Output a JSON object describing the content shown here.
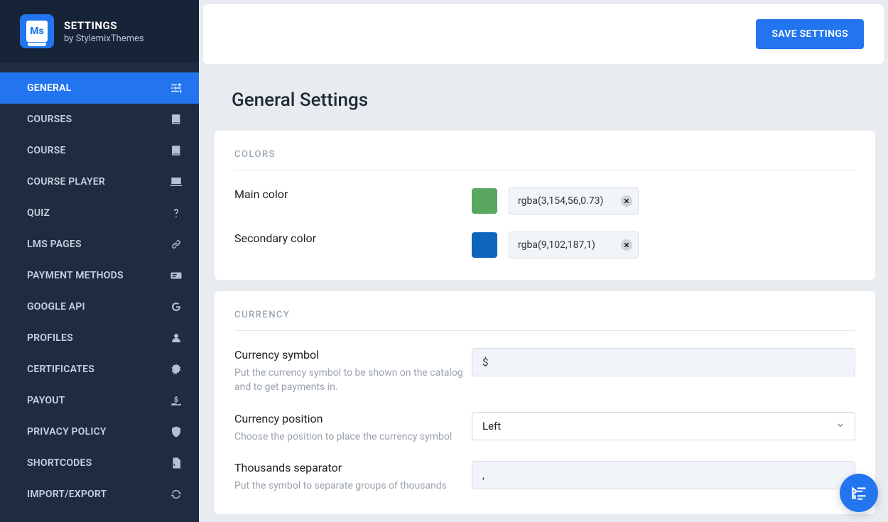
{
  "brand": {
    "title": "SETTINGS",
    "subtitle": "by StylemixThemes",
    "logo_text": "Ms"
  },
  "actions": {
    "save_label": "SAVE SETTINGS"
  },
  "page": {
    "title": "General Settings"
  },
  "sections": {
    "colors": {
      "heading": "COLORS",
      "main": {
        "label": "Main color",
        "value": "rgba(3,154,56,0.73)",
        "swatch": "#5aa761"
      },
      "secondary": {
        "label": "Secondary color",
        "value": "rgba(9,102,187,1)",
        "swatch": "#0d66bb"
      }
    },
    "currency": {
      "heading": "CURRENCY",
      "symbol": {
        "label": "Currency symbol",
        "desc": "Put the currency symbol to be shown on the catalog and to get payments in.",
        "value": "$"
      },
      "position": {
        "label": "Currency position",
        "desc": "Choose the position to place the currency symbol",
        "value": "Left"
      },
      "thousands": {
        "label": "Thousands separator",
        "desc": "Put the symbol to separate groups of thousands",
        "value": ","
      }
    }
  },
  "sidebar": {
    "items": [
      {
        "label": "GENERAL",
        "icon": "sliders",
        "active": true
      },
      {
        "label": "COURSES",
        "icon": "book"
      },
      {
        "label": "COURSE",
        "icon": "book"
      },
      {
        "label": "COURSE PLAYER",
        "icon": "chalkboard"
      },
      {
        "label": "QUIZ",
        "icon": "question"
      },
      {
        "label": "LMS PAGES",
        "icon": "link"
      },
      {
        "label": "PAYMENT METHODS",
        "icon": "money-check"
      },
      {
        "label": "GOOGLE API",
        "icon": "google"
      },
      {
        "label": "PROFILES",
        "icon": "user"
      },
      {
        "label": "CERTIFICATES",
        "icon": "certificate"
      },
      {
        "label": "PAYOUT",
        "icon": "hand-coin"
      },
      {
        "label": "PRIVACY POLICY",
        "icon": "shield"
      },
      {
        "label": "SHORTCODES",
        "icon": "file-code"
      },
      {
        "label": "IMPORT/EXPORT",
        "icon": "sync"
      }
    ]
  }
}
